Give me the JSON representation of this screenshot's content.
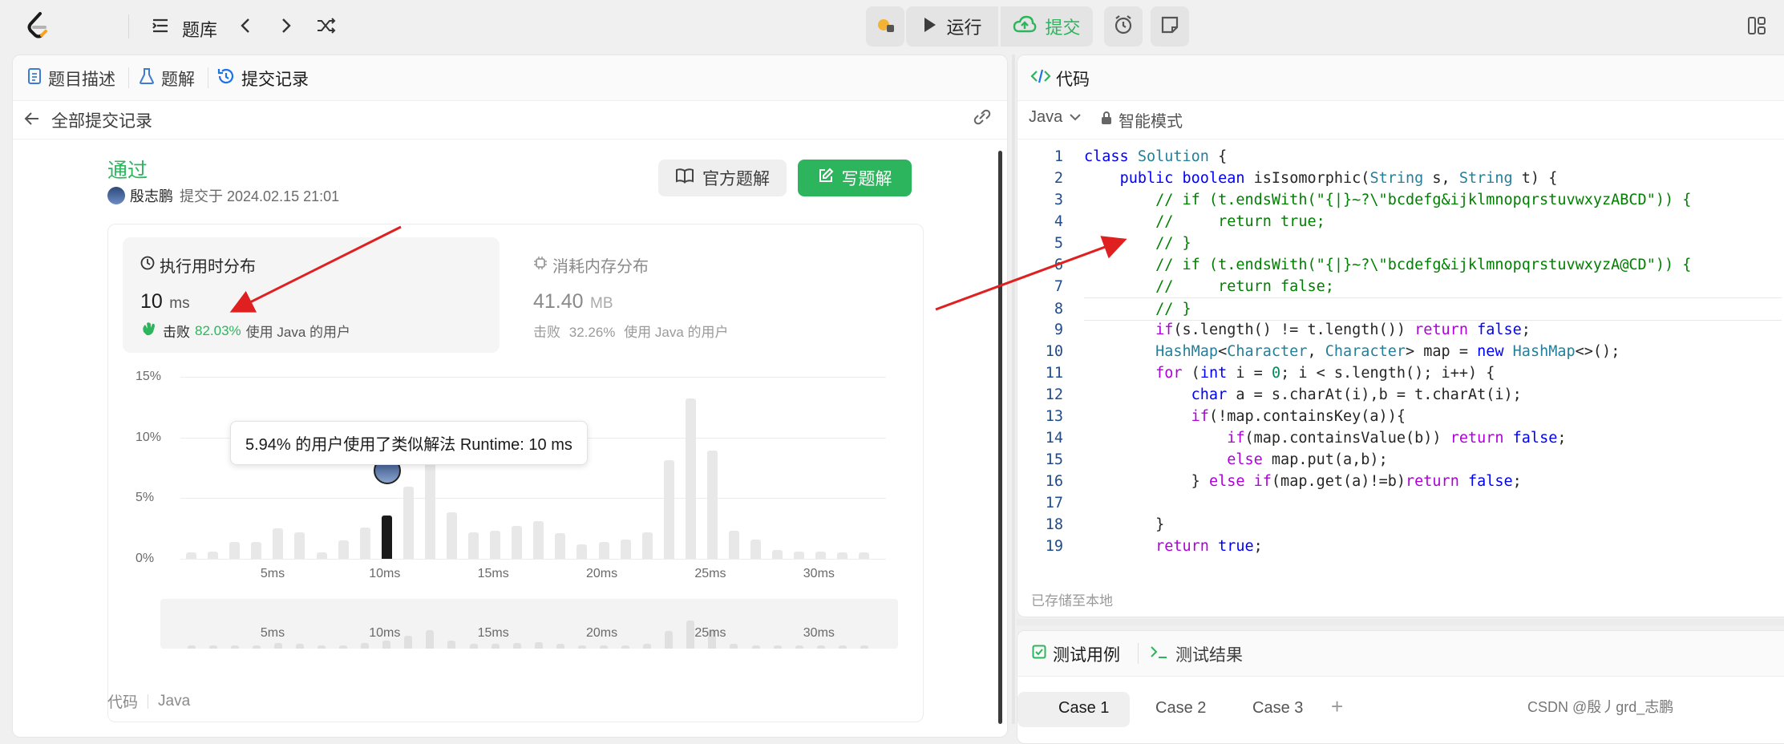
{
  "topbar": {
    "problem_bank": "题库",
    "run": "运行",
    "submit": "提交"
  },
  "left": {
    "tabs": [
      "题目描述",
      "题解",
      "提交记录"
    ],
    "back_label": "全部提交记录",
    "status": "通过",
    "user": "殷志鹏",
    "submitted_at": "提交于 2024.02.15 21:01",
    "official_solution": "官方题解",
    "write_solution": "写题解",
    "runtime": {
      "title": "执行用时分布",
      "value": "10",
      "unit": "ms",
      "beat_label": "击败",
      "beat_value": "82.03%",
      "beat_suffix": "使用 Java 的用户"
    },
    "memory": {
      "title": "消耗内存分布",
      "value": "41.40",
      "unit": "MB",
      "beat_label": "击败",
      "beat_value": "32.26%",
      "beat_suffix": "使用 Java 的用户"
    },
    "tooltip": "5.94% 的用户使用了类似解法 Runtime: 10 ms",
    "code_label": "代码",
    "code_lang": "Java"
  },
  "chart_data": {
    "type": "bar",
    "x": [
      1,
      2,
      3,
      4,
      5,
      6,
      7,
      8,
      9,
      10,
      11,
      12,
      13,
      14,
      15,
      16,
      17,
      18,
      19,
      20,
      21,
      22,
      23,
      24,
      25,
      26,
      27,
      28,
      29,
      30,
      31,
      32
    ],
    "values": [
      0.5,
      0.6,
      1.4,
      1.4,
      2.5,
      2.2,
      0.5,
      1.5,
      2.6,
      3.6,
      5.94,
      8.8,
      3.8,
      2.2,
      2.3,
      2.7,
      3.1,
      2.1,
      1.2,
      1.4,
      1.6,
      2.2,
      8.1,
      13.2,
      8.9,
      2.3,
      1.6,
      0.7,
      0.6,
      0.6,
      0.5,
      0.5
    ],
    "highlight_x": 10,
    "ylim": [
      0,
      15
    ],
    "yticks": [
      "0%",
      "5%",
      "10%",
      "15%"
    ],
    "xticks": [
      "5ms",
      "10ms",
      "15ms",
      "20ms",
      "25ms",
      "30ms"
    ],
    "xtick_values": [
      5,
      10,
      15,
      20,
      25,
      30
    ]
  },
  "right": {
    "title": "代码",
    "language": "Java",
    "mode": "智能模式",
    "saved": "已存储至本地",
    "bottom_tabs": [
      "测试用例",
      "测试结果"
    ],
    "cases": [
      "Case 1",
      "Case 2",
      "Case 3"
    ],
    "add": "+",
    "watermark": "CSDN @殷丿grd_志鹏",
    "code_lines": [
      "class Solution {",
      "    public boolean isIsomorphic(String s, String t) {",
      "        // if (t.endsWith(\"{|}~?\\\"bcdefg&ijklmnopqrstuvwxyzABCD\")) {",
      "        //     return true;",
      "        // }",
      "        // if (t.endsWith(\"{|}~?\\\"bcdefg&ijklmnopqrstuvwxyzA@CD\")) {",
      "        //     return false;",
      "        // }",
      "        if(s.length() != t.length()) return false;",
      "        HashMap<Character, Character> map = new HashMap<>();",
      "        for (int i = 0; i < s.length(); i++) {",
      "            char a = s.charAt(i),b = t.charAt(i);",
      "            if(!map.containsKey(a)){",
      "                if(map.containsValue(b)) return false;",
      "                else map.put(a,b);",
      "            } else if(map.get(a)!=b)return false;",
      "",
      "        }",
      "        return true;"
    ]
  },
  "colors": {
    "green": "#2db55d",
    "accent_blue": "#1a73e8",
    "red_arrow": "#e02020"
  }
}
